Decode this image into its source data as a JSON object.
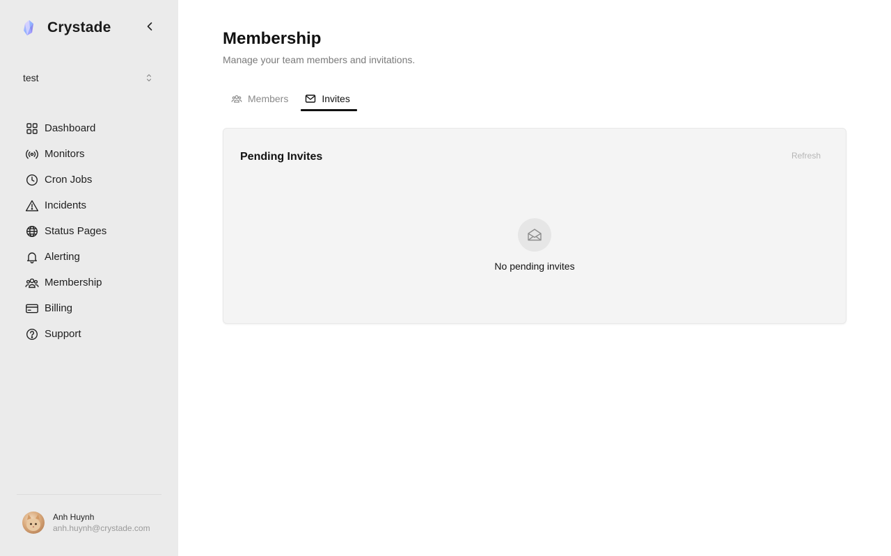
{
  "brand": {
    "name": "Crystade"
  },
  "team": {
    "name": "test"
  },
  "nav": {
    "items": [
      {
        "label": "Dashboard",
        "icon": "grid-icon"
      },
      {
        "label": "Monitors",
        "icon": "broadcast-icon"
      },
      {
        "label": "Cron Jobs",
        "icon": "clock-icon"
      },
      {
        "label": "Incidents",
        "icon": "warning-triangle-icon"
      },
      {
        "label": "Status Pages",
        "icon": "globe-icon"
      },
      {
        "label": "Alerting",
        "icon": "bell-icon"
      },
      {
        "label": "Membership",
        "icon": "users-icon"
      },
      {
        "label": "Billing",
        "icon": "credit-card-icon"
      },
      {
        "label": "Support",
        "icon": "help-circle-icon"
      }
    ]
  },
  "user": {
    "name": "Anh Huynh",
    "email": "anh.huynh@crystade.com"
  },
  "page": {
    "title": "Membership",
    "subtitle": "Manage your team members and invitations."
  },
  "tabs": [
    {
      "label": "Members",
      "icon": "users-icon",
      "active": false
    },
    {
      "label": "Invites",
      "icon": "mail-icon",
      "active": true
    }
  ],
  "invites": {
    "title": "Pending Invites",
    "refresh_label": "Refresh",
    "empty_text": "No pending invites",
    "empty_icon": "mail-open-icon"
  },
  "colors": {
    "sidebar_bg": "#ebebeb",
    "card_bg": "#f4f4f4",
    "active_tab_underline": "#111111",
    "muted_text": "#7a7a7a"
  }
}
